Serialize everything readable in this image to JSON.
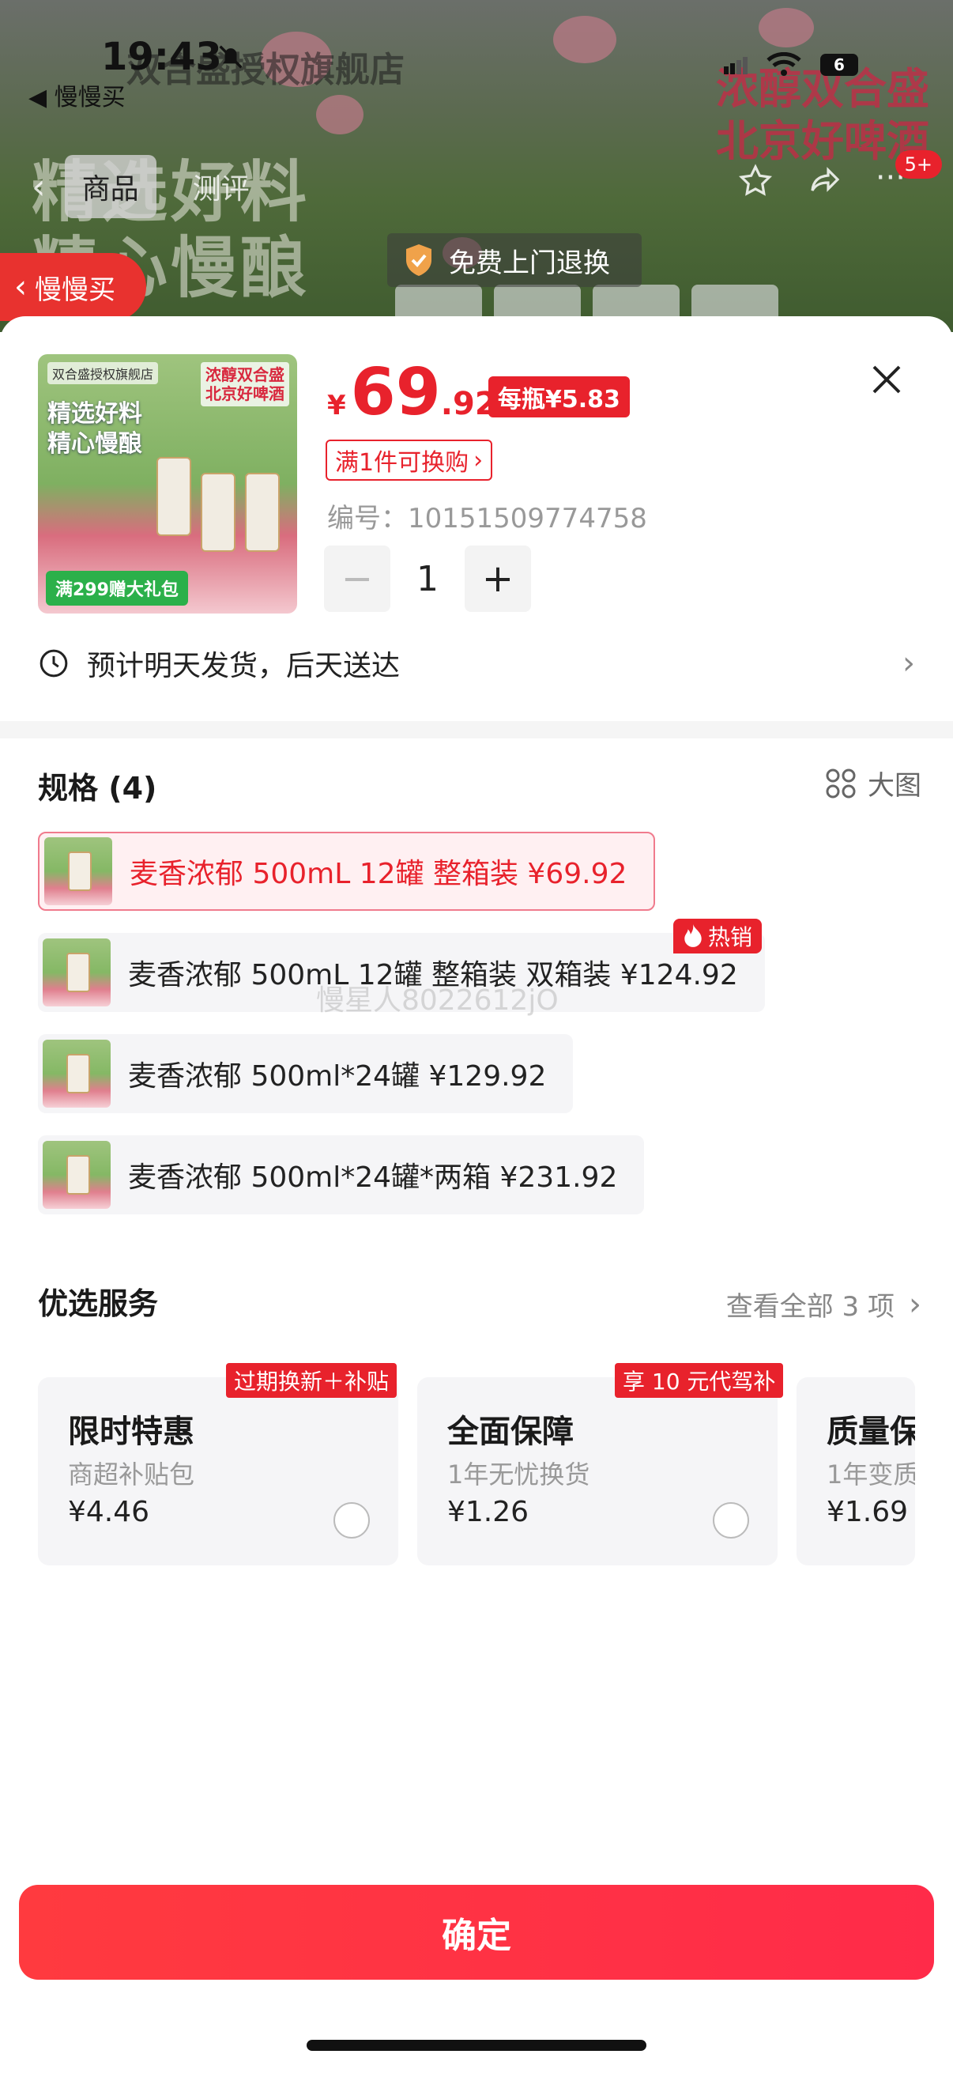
{
  "status_bar": {
    "time": "19:43",
    "back_app": "◀ 慢慢买",
    "battery": "6"
  },
  "background": {
    "shop_name": "双合盛授权旗舰店",
    "tab_goods": "商品",
    "tab_review": "测评",
    "slogan_line1": "浓醇双合盛",
    "slogan_line2": "北京好啤酒",
    "headline_line1": "精选好料",
    "headline_line2": "精心慢酿",
    "cart_badge": "5+",
    "free_return": "免费上门退换",
    "slow_buy": "慢慢买"
  },
  "product": {
    "thumb_shop": "双合盛授权旗舰店",
    "thumb_slogan1": "浓醇双合盛",
    "thumb_slogan2": "北京好啤酒",
    "thumb_line1": "精选好料",
    "thumb_line2": "精心慢酿",
    "thumb_gift": "满299赠大礼包",
    "price_symbol": "¥",
    "price_int": "69",
    "price_dec": ".92",
    "per_bottle": "每瓶¥5.83",
    "swap_tag": "满1件可换购",
    "sku_label": "编号：",
    "sku_value": "10151509774758",
    "quantity": "1",
    "minus": "−",
    "plus": "+"
  },
  "delivery": {
    "text": "预计明天发货，后天送达"
  },
  "specs": {
    "title": "规格 (4)",
    "big_image_label": "大图",
    "hot_label": "热销",
    "watermark": "慢星人8022612jO",
    "options": [
      {
        "label": "麦香浓郁 500mL 12罐 整箱装  ¥69.92",
        "selected": true
      },
      {
        "label": "麦香浓郁 500mL 12罐 整箱装 双箱装  ¥124.92",
        "selected": false
      },
      {
        "label": "麦香浓郁 500ml*24罐  ¥129.92",
        "selected": false
      },
      {
        "label": "麦香浓郁 500ml*24罐*两箱  ¥231.92",
        "selected": false
      }
    ]
  },
  "services": {
    "title": "优选服务",
    "see_all": "查看全部 3 项",
    "cards": [
      {
        "tag": "过期换新＋补贴",
        "title": "限时特惠",
        "subtitle": "商超补贴包",
        "price": "¥4.46"
      },
      {
        "tag": "享 10 元代驾补",
        "title": "全面保障",
        "subtitle": "1年无忧换货",
        "price": "¥1.26"
      },
      {
        "tag": "",
        "title": "质量保障",
        "subtitle": "1年变质",
        "price": "¥1.69"
      }
    ]
  },
  "confirm_label": "确定",
  "colors": {
    "accent": "#e8222c",
    "selected_bg": "#fff0f2",
    "option_bg": "#f5f5f7"
  }
}
